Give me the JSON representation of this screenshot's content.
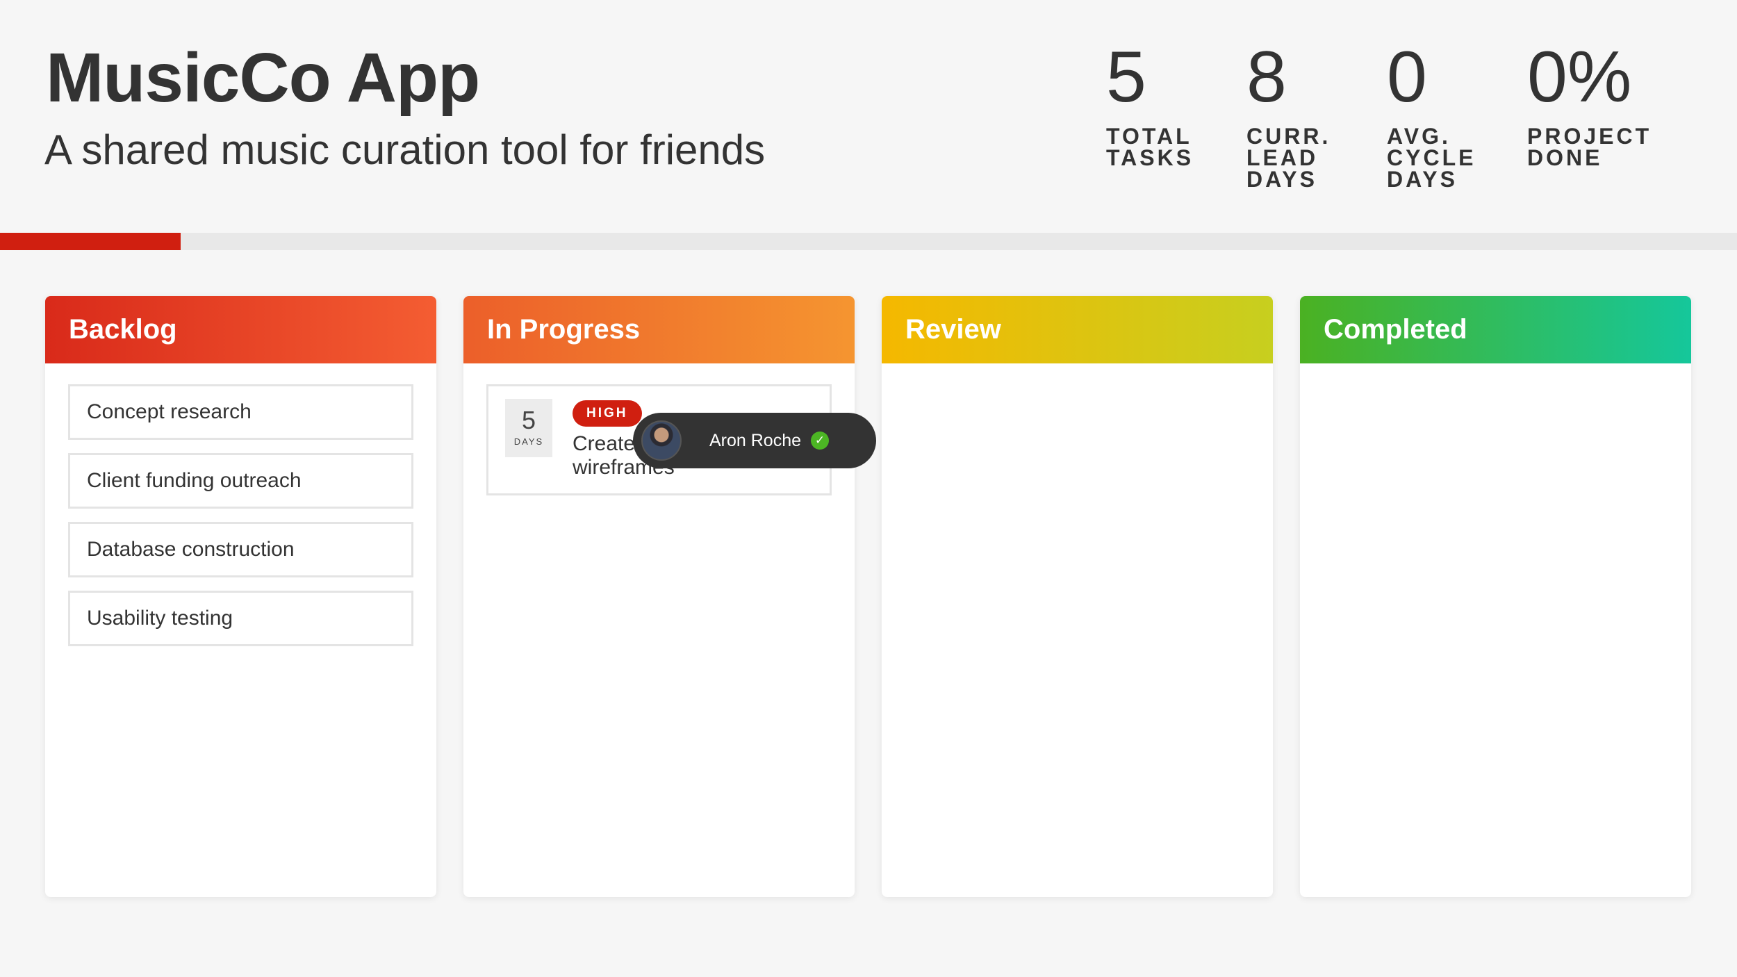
{
  "app": {
    "title": "MusicCo App",
    "subtitle": "A shared music curation tool for friends"
  },
  "stats": [
    {
      "value": "5",
      "label": "Total tasks"
    },
    {
      "value": "8",
      "label": "Curr. lead days"
    },
    {
      "value": "0",
      "label": "Avg. cycle days"
    },
    {
      "value": "0%",
      "label": "Project done"
    }
  ],
  "progress": {
    "fraction": 0.104,
    "color": "#d01f10"
  },
  "columns": [
    {
      "title": "Backlog",
      "gradient": [
        "#d92a1a",
        "#f45d32"
      ],
      "tasks": [
        "Concept research",
        "Client funding outreach",
        "Database construction",
        "Usability testing"
      ]
    },
    {
      "title": "In Progress",
      "gradient": [
        "#ec5f2a",
        "#f59530"
      ],
      "card": {
        "days": "5",
        "days_label": "DAYS",
        "priority": "HIGH",
        "title": "Create wireframes",
        "assignee": {
          "name": "Aron Roche",
          "icon": "check-circle-icon",
          "status_color": "#4cb624"
        }
      }
    },
    {
      "title": "Review",
      "gradient": [
        "#f5b800",
        "#c7cf1f"
      ]
    },
    {
      "title": "Completed",
      "gradient": [
        "#4bb122",
        "#15c79b"
      ]
    }
  ]
}
